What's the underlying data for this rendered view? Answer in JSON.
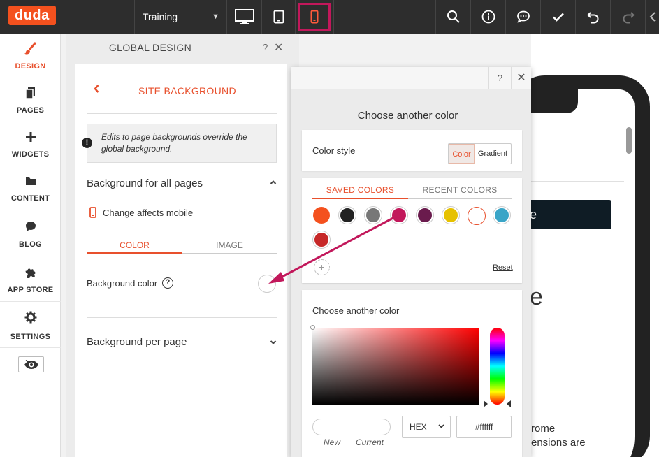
{
  "topbar": {
    "logo": "duda",
    "site_name": "Training",
    "devices": [
      "desktop-icon",
      "tablet-icon",
      "mobile-icon"
    ],
    "active_device": "mobile",
    "tools": [
      "search-icon",
      "info-icon",
      "comment-icon",
      "check-icon",
      "undo-icon",
      "redo-icon"
    ],
    "accent": "#c2185b"
  },
  "leftnav": {
    "items": [
      {
        "label": "DESIGN",
        "icon": "brush-icon",
        "active": true
      },
      {
        "label": "PAGES",
        "icon": "pages-icon"
      },
      {
        "label": "WIDGETS",
        "icon": "plus-icon"
      },
      {
        "label": "CONTENT",
        "icon": "folder-icon"
      },
      {
        "label": "BLOG",
        "icon": "chat-bubble-icon"
      },
      {
        "label": "APP STORE",
        "icon": "puzzle-icon"
      },
      {
        "label": "SETTINGS",
        "icon": "gear-icon"
      }
    ],
    "preview_toggle": "eye-off-icon"
  },
  "global_design": {
    "title": "GLOBAL DESIGN",
    "help": "?",
    "close": "✕"
  },
  "site_background": {
    "title": "SITE BACKGROUND",
    "note": "Edits to page backgrounds override the global background.",
    "section_all": "Background for all pages",
    "mobile_note": "Change affects mobile",
    "tabs": [
      "COLOR",
      "IMAGE"
    ],
    "bg_color_label": "Background color",
    "section_per_page": "Background per page"
  },
  "picker": {
    "help": "?",
    "close": "✕",
    "title": "Choose another color",
    "color_style_label": "Color style",
    "style_options": [
      "Color",
      "Gradient"
    ],
    "tabs": [
      "SAVED COLORS",
      "RECENT COLORS"
    ],
    "saved_colors": [
      "#f4511e",
      "#222222",
      "#777777",
      "#c2185b",
      "#6a1b4d",
      "#e6c100",
      "#ffffff",
      "#3aa5c7",
      "#c62828"
    ],
    "add": "+",
    "reset": "Reset",
    "custom_title": "Choose another color",
    "format": "HEX",
    "hex_value": "#ffffff",
    "new_label": "New",
    "current_label": "Current"
  },
  "preview": {
    "button_text": "e",
    "big_text": "e",
    "line1": "rome",
    "line2": "ensions are"
  }
}
